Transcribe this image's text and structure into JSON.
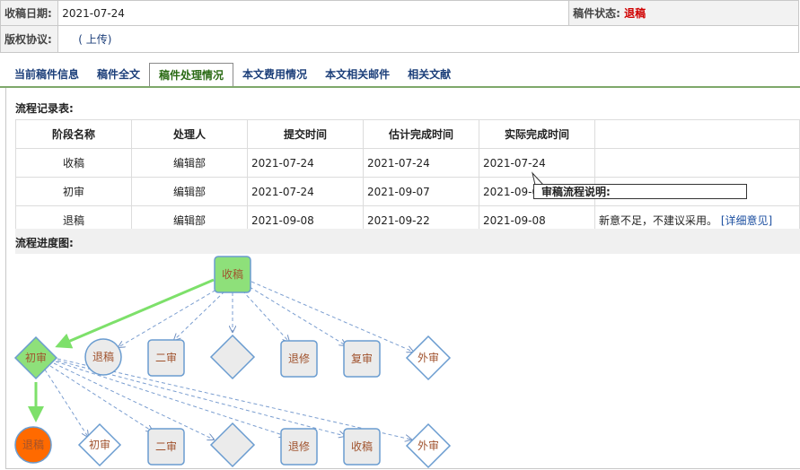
{
  "info": {
    "date_label": "收稿日期:",
    "date_value": "2021-07-24",
    "status_label": "稿件状态:",
    "status_value": "退稿",
    "copyright_label": "版权协议:",
    "upload_link": "( 上传)"
  },
  "tabs": [
    "当前稿件信息",
    "稿件全文",
    "稿件处理情况",
    "本文费用情况",
    "本文相关邮件",
    "相关文献"
  ],
  "records": {
    "title": "流程记录表:",
    "headers": [
      "阶段名称",
      "处理人",
      "提交时间",
      "估计完成时间",
      "实际完成时间"
    ],
    "rows": [
      {
        "stage": "收稿",
        "handler": "编辑部",
        "submit": "2021-07-24",
        "estimate": "2021-07-24",
        "actual": "2021-07-24",
        "note": "",
        "detail": ""
      },
      {
        "stage": "初审",
        "handler": "编辑部",
        "submit": "2021-07-24",
        "estimate": "2021-09-07",
        "actual": "2021-09-08",
        "note": "",
        "detail": ""
      },
      {
        "stage": "退稿",
        "handler": "编辑部",
        "submit": "2021-09-08",
        "estimate": "2021-09-22",
        "actual": "2021-09-08",
        "note": "新意不足，不建议采用。",
        "detail": "[详细意见]"
      }
    ]
  },
  "tooltip": "审稿流程说明:",
  "progress": {
    "title": "流程进度图:",
    "nodes": {
      "shougao_top": "收稿",
      "chushen": "初审",
      "tuigao1": "退稿",
      "ershen1": "二审",
      "tuixiu1": "退修",
      "fushen": "复审",
      "waishen1": "外审",
      "tuigao2": "退稿",
      "chushen2": "初审",
      "ershen2": "二审",
      "tuixiu2": "退修",
      "shougao2": "收稿",
      "waishen2": "外审"
    }
  }
}
